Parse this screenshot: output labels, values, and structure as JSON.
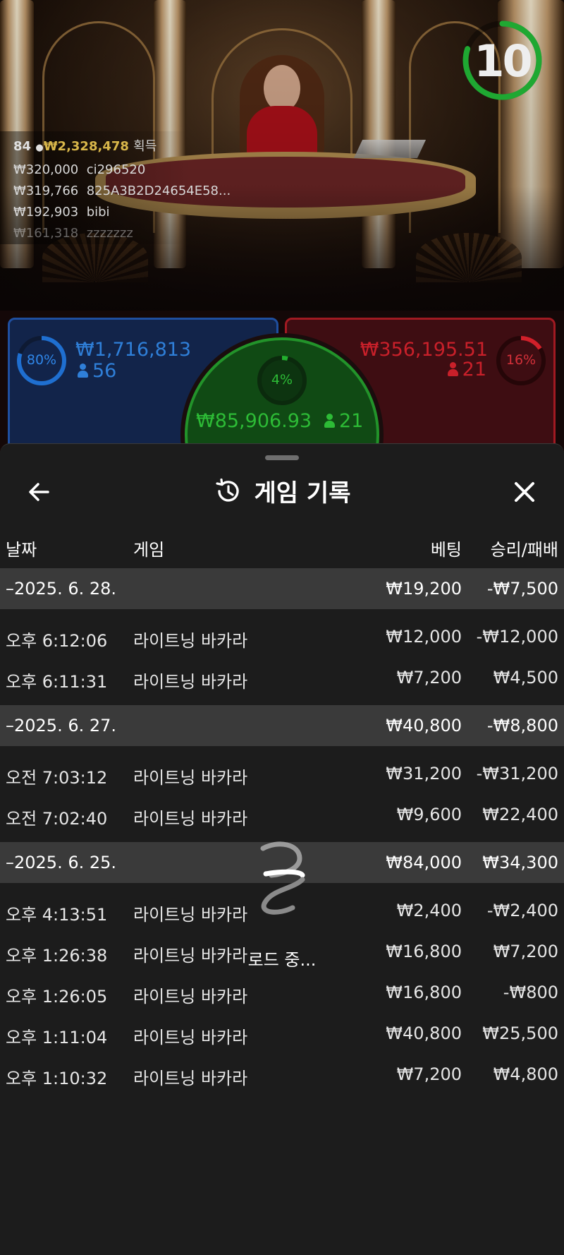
{
  "timer": {
    "value": "10",
    "progress": 0.8,
    "color": "#1fa832"
  },
  "winners": {
    "count": "84",
    "total": "₩2,328,478",
    "suffix": "획득",
    "list": [
      {
        "amount": "₩320,000",
        "name": "ci296520"
      },
      {
        "amount": "₩319,766",
        "name": "825A3B2D24654E58..."
      },
      {
        "amount": "₩192,903",
        "name": "bibi"
      },
      {
        "amount": "₩161,318",
        "name": "zzzzzzz"
      }
    ]
  },
  "bets": {
    "player": {
      "percent": "80%",
      "percent_value": 0.8,
      "amount": "₩1,716,813",
      "count": "56",
      "color": "#1f6fd0"
    },
    "tie": {
      "percent": "4%",
      "percent_value": 0.04,
      "amount": "₩85,906.93",
      "count": "21",
      "color": "#22b02e"
    },
    "banker": {
      "percent": "16%",
      "percent_value": 0.16,
      "amount": "₩356,195.51",
      "count": "21",
      "color": "#d0202a"
    }
  },
  "history": {
    "title": "게임 기록",
    "icons": {
      "back": "arrow-left-icon",
      "history": "history-icon",
      "close": "close-icon"
    },
    "columns": {
      "date": "날짜",
      "game": "게임",
      "bet": "베팅",
      "result": "승리/패배"
    },
    "groups": [
      {
        "date": "–2025. 6. 28.",
        "bet": "₩19,200",
        "result": "-₩7,500",
        "rows": [
          {
            "time": "오후 6:12:06",
            "game": "라이트닝 바카라",
            "bet": "₩12,000",
            "result": "-₩12,000"
          },
          {
            "time": "오후 6:11:31",
            "game": "라이트닝 바카라",
            "bet": "₩7,200",
            "result": "₩4,500"
          }
        ]
      },
      {
        "date": "–2025. 6. 27.",
        "bet": "₩40,800",
        "result": "-₩8,800",
        "rows": [
          {
            "time": "오전 7:03:12",
            "game": "라이트닝 바카라",
            "bet": "₩31,200",
            "result": "-₩31,200"
          },
          {
            "time": "오전 7:02:40",
            "game": "라이트닝 바카라",
            "bet": "₩9,600",
            "result": "₩22,400"
          }
        ]
      },
      {
        "date": "–2025. 6. 25.",
        "bet": "₩84,000",
        "result": "₩34,300",
        "rows": [
          {
            "time": "오후 4:13:51",
            "game": "라이트닝 바카라",
            "bet": "₩2,400",
            "result": "-₩2,400"
          },
          {
            "time": "오후 1:26:38",
            "game": "라이트닝 바카라",
            "bet": "₩16,800",
            "result": "₩7,200"
          },
          {
            "time": "오후 1:26:05",
            "game": "라이트닝 바카라",
            "bet": "₩16,800",
            "result": "-₩800"
          },
          {
            "time": "오후 1:11:04",
            "game": "라이트닝 바카라",
            "bet": "₩40,800",
            "result": "₩25,500"
          },
          {
            "time": "오후 1:10:32",
            "game": "라이트닝 바카라",
            "bet": "₩7,200",
            "result": "₩4,800"
          }
        ]
      }
    ]
  },
  "loader": {
    "text": "로드 중...",
    "icon": "spinner-icon"
  }
}
